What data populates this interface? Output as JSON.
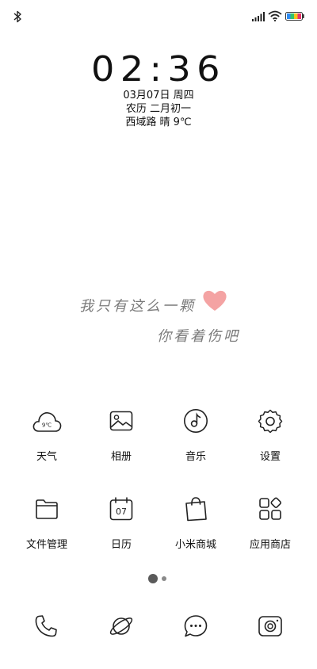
{
  "status_bar": {
    "icons": [
      "bluetooth-icon",
      "cellular-signal-icon",
      "wifi-icon",
      "battery-icon"
    ],
    "battery_colors": [
      "#e8326b",
      "#f6c21b",
      "#36c26a",
      "#2f8cf1"
    ]
  },
  "lockscreen": {
    "time": "02:36",
    "date": "03月07日 周四",
    "lunar": "农历 二月初一",
    "weather_line": "西域路 晴 9℃"
  },
  "handwriting": {
    "line1": "我只有这么一颗",
    "line2": "你看着伤吧",
    "heart_color": "#f4a3a3"
  },
  "apps": [
    {
      "label": "天气",
      "icon": "weather-cloud-icon",
      "badge_text": "9℃"
    },
    {
      "label": "相册",
      "icon": "gallery-icon"
    },
    {
      "label": "音乐",
      "icon": "music-icon"
    },
    {
      "label": "设置",
      "icon": "settings-gear-icon"
    },
    {
      "label": "文件管理",
      "icon": "folder-icon"
    },
    {
      "label": "日历",
      "icon": "calendar-icon",
      "badge_text": "07"
    },
    {
      "label": "小米商城",
      "icon": "shopping-bag-icon"
    },
    {
      "label": "应用商店",
      "icon": "app-store-icon"
    }
  ],
  "page_indicator": {
    "pages": 2,
    "current": 1
  },
  "dock": [
    {
      "icon": "phone-icon"
    },
    {
      "icon": "browser-planet-icon"
    },
    {
      "icon": "messages-icon"
    },
    {
      "icon": "camera-icon"
    }
  ]
}
